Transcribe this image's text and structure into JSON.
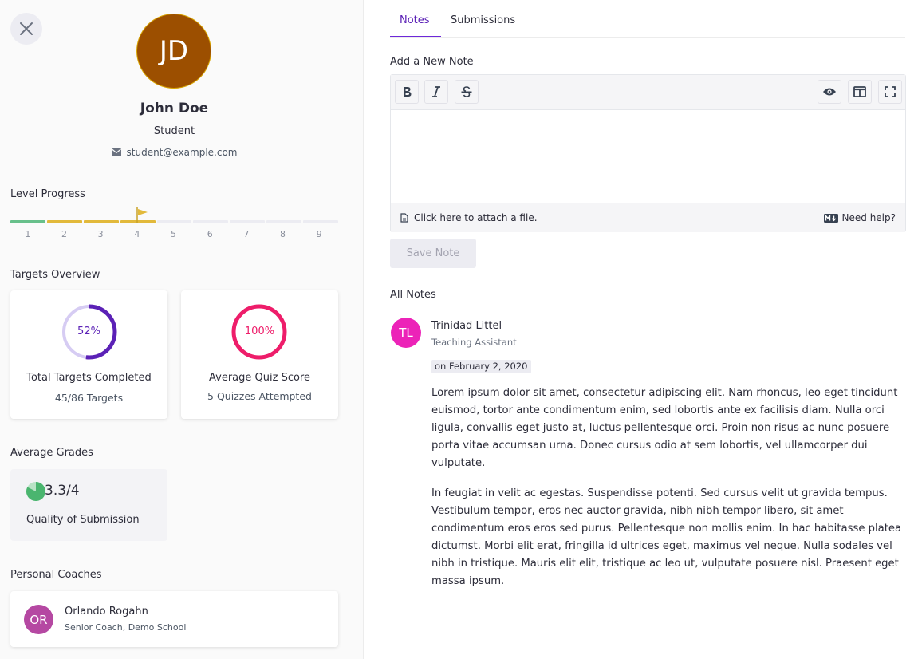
{
  "profile": {
    "initials": "JD",
    "name": "John Doe",
    "role": "Student",
    "email": "student@example.com"
  },
  "level_progress": {
    "title": "Level Progress",
    "levels": [
      "1",
      "2",
      "3",
      "4",
      "5",
      "6",
      "7",
      "8",
      "9"
    ],
    "completed_levels": 1,
    "current_level": 4
  },
  "targets_overview": {
    "title": "Targets Overview",
    "targets_card": {
      "percent_label": "52%",
      "percent": 52,
      "title": "Total Targets Completed",
      "subtitle": "45/86 Targets"
    },
    "quiz_card": {
      "percent_label": "100%",
      "percent": 100,
      "title": "Average Quiz Score",
      "subtitle": "5 Quizzes Attempted"
    }
  },
  "average_grades": {
    "title": "Average Grades",
    "value": "3.3/4",
    "label": "Quality of Submission",
    "fraction": 0.825
  },
  "personal_coaches": {
    "title": "Personal Coaches",
    "coaches": [
      {
        "initials": "OR",
        "name": "Orlando Rogahn",
        "title": "Senior Coach, Demo School"
      }
    ]
  },
  "tabs": [
    {
      "label": "Notes",
      "active": true
    },
    {
      "label": "Submissions",
      "active": false
    }
  ],
  "editor": {
    "heading": "Add a New Note",
    "attach_label": "Click here to attach a file.",
    "help_label": "Need help?",
    "save_label": "Save Note"
  },
  "notes": {
    "heading": "All Notes",
    "items": [
      {
        "initials": "TL",
        "author": "Trinidad Littel",
        "role": "Teaching Assistant",
        "date": "on February 2, 2020",
        "paragraphs": [
          "Lorem ipsum dolor sit amet, consectetur adipiscing elit. Nam rhoncus, leo eget tincidunt euismod, tortor ante condimentum enim, sed lobortis ante ex facilisis diam. Nulla orci ligula, convallis eget justo at, luctus pellentesque orci. Proin non risus ac nunc posuere porta vitae accumsan urna. Donec cursus odio at sem lobortis, vel ullamcorper dui vulputate.",
          "In feugiat in velit ac egestas. Suspendisse potenti. Sed cursus velit ut gravida tempus. Vestibulum tempor, eros nec auctor gravida, nibh nibh tempor libero, sit amet condimentum eros eros sed purus. Pellentesque non mollis enim. In hac habitasse platea dictumst. Morbi elit erat, fringilla id ultrices eget, maximus vel neque. Nulla sodales vel nibh in tristique. Mauris elit elit, tristique ac leo ut, vulputate posuere nisl. Praesent eget massa ipsum."
        ]
      }
    ]
  },
  "colors": {
    "accent": "#6d28d9",
    "quiz_ring": "#ee1d6a",
    "level_done": "#68c08b",
    "level_current": "#e2b93b",
    "grade_pie": "#4ab56f"
  }
}
